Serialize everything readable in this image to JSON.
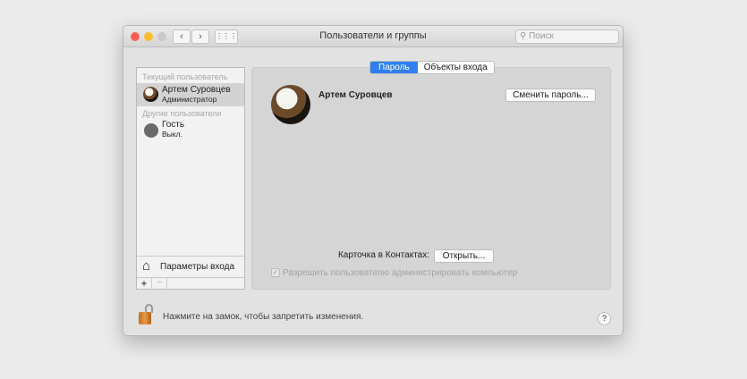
{
  "window": {
    "title": "Пользователи и группы",
    "search_placeholder": "Поиск",
    "back": "‹",
    "forward": "›",
    "grid": "⋮⋮⋮"
  },
  "sidebar": {
    "current_header": "Текущий пользователь",
    "current_user": {
      "name": "Артем Суровцев",
      "role": "Администратор"
    },
    "other_header": "Другие пользователи",
    "other_users": [
      {
        "name": "Гость",
        "status": "Выкл."
      }
    ],
    "login_options": "Параметры входа",
    "add": "+",
    "remove": "−"
  },
  "tabs": [
    {
      "label": "Пароль",
      "active": true
    },
    {
      "label": "Объекты входа",
      "active": false
    }
  ],
  "main": {
    "user_name": "Артем Суровцев",
    "change_password": "Сменить пароль...",
    "contacts_label": "Карточка в Контактах:",
    "open_button": "Открыть...",
    "allow_admin": "Разрешить пользователю администрировать компьютер",
    "allow_admin_checked": true
  },
  "footer": {
    "lock_text": "Нажмите на замок, чтобы запретить изменения.",
    "help": "?"
  },
  "colors": {
    "accent": "#2f7ff0"
  }
}
